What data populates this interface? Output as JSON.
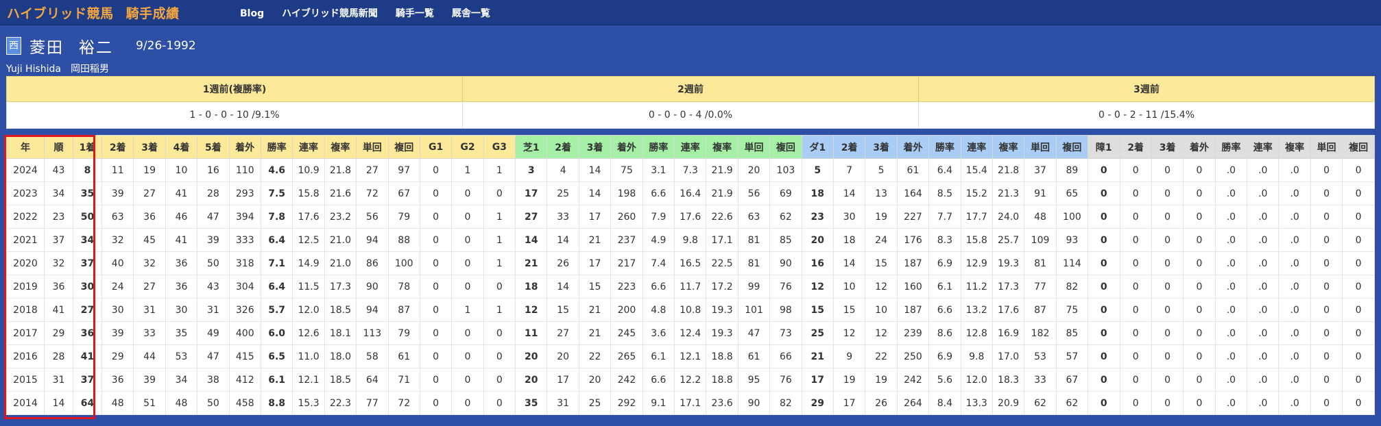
{
  "header": {
    "brand": "ハイブリッド競馬",
    "section": "騎手成績",
    "nav": [
      "Blog",
      "ハイブリッド競馬新聞",
      "騎手一覧",
      "厩舎一覧"
    ]
  },
  "profile": {
    "region": "西",
    "name_family": "菱田",
    "name_given": "裕二",
    "dob": "9/26-1992",
    "name_en": "Yuji Hishida",
    "master": "岡田稲男"
  },
  "weeks": {
    "headers": [
      "1週前(複勝率)",
      "2週前",
      "3週前"
    ],
    "values": [
      "1 - 0 - 0 - 10 /9.1%",
      "0 - 0 - 0 - 4 /0.0%",
      "0 - 0 - 2 - 11 /15.4%"
    ]
  },
  "stats": {
    "headers": [
      "年",
      "順",
      "1着",
      "2着",
      "3着",
      "4着",
      "5着",
      "着外",
      "勝率",
      "連率",
      "複率",
      "単回",
      "複回",
      "G1",
      "G2",
      "G3",
      "芝1",
      "2着",
      "3着",
      "着外",
      "勝率",
      "連率",
      "複率",
      "単回",
      "複回",
      "ダ1",
      "2着",
      "3着",
      "着外",
      "勝率",
      "連率",
      "複率",
      "単回",
      "複回",
      "障1",
      "2着",
      "3着",
      "着外",
      "勝率",
      "連率",
      "複率",
      "単回",
      "複回"
    ],
    "rows": [
      [
        "2024",
        "43",
        "8",
        "11",
        "19",
        "10",
        "16",
        "110",
        "4.6",
        "10.9",
        "21.8",
        "27",
        "97",
        "0",
        "1",
        "1",
        "3",
        "4",
        "14",
        "75",
        "3.1",
        "7.3",
        "21.9",
        "20",
        "103",
        "5",
        "7",
        "5",
        "61",
        "6.4",
        "15.4",
        "21.8",
        "37",
        "89",
        "0",
        "0",
        "0",
        "0",
        ".0",
        ".0",
        ".0",
        "0",
        "0"
      ],
      [
        "2023",
        "34",
        "35",
        "39",
        "27",
        "41",
        "28",
        "293",
        "7.5",
        "15.8",
        "21.6",
        "72",
        "67",
        "0",
        "0",
        "0",
        "17",
        "25",
        "14",
        "198",
        "6.6",
        "16.4",
        "21.9",
        "56",
        "69",
        "18",
        "14",
        "13",
        "164",
        "8.5",
        "15.2",
        "21.3",
        "91",
        "65",
        "0",
        "0",
        "0",
        "0",
        ".0",
        ".0",
        ".0",
        "0",
        "0"
      ],
      [
        "2022",
        "23",
        "50",
        "63",
        "36",
        "46",
        "47",
        "394",
        "7.8",
        "17.6",
        "23.2",
        "56",
        "79",
        "0",
        "0",
        "1",
        "27",
        "33",
        "17",
        "260",
        "7.9",
        "17.6",
        "22.6",
        "63",
        "62",
        "23",
        "30",
        "19",
        "227",
        "7.7",
        "17.7",
        "24.0",
        "48",
        "100",
        "0",
        "0",
        "0",
        "0",
        ".0",
        ".0",
        ".0",
        "0",
        "0"
      ],
      [
        "2021",
        "37",
        "34",
        "32",
        "45",
        "41",
        "39",
        "333",
        "6.4",
        "12.5",
        "21.0",
        "94",
        "88",
        "0",
        "0",
        "1",
        "14",
        "14",
        "21",
        "237",
        "4.9",
        "9.8",
        "17.1",
        "81",
        "85",
        "20",
        "18",
        "24",
        "176",
        "8.3",
        "15.8",
        "25.7",
        "109",
        "93",
        "0",
        "0",
        "0",
        "0",
        ".0",
        ".0",
        ".0",
        "0",
        "0"
      ],
      [
        "2020",
        "32",
        "37",
        "40",
        "32",
        "36",
        "50",
        "318",
        "7.1",
        "14.9",
        "21.0",
        "86",
        "100",
        "0",
        "0",
        "1",
        "21",
        "26",
        "17",
        "217",
        "7.4",
        "16.5",
        "22.5",
        "81",
        "90",
        "16",
        "14",
        "15",
        "187",
        "6.9",
        "12.9",
        "19.3",
        "81",
        "114",
        "0",
        "0",
        "0",
        "0",
        ".0",
        ".0",
        ".0",
        "0",
        "0"
      ],
      [
        "2019",
        "36",
        "30",
        "24",
        "27",
        "36",
        "43",
        "304",
        "6.4",
        "11.5",
        "17.3",
        "90",
        "78",
        "0",
        "0",
        "0",
        "18",
        "14",
        "15",
        "223",
        "6.6",
        "11.7",
        "17.2",
        "99",
        "76",
        "12",
        "10",
        "12",
        "160",
        "6.1",
        "11.2",
        "17.3",
        "77",
        "82",
        "0",
        "0",
        "0",
        "0",
        ".0",
        ".0",
        ".0",
        "0",
        "0"
      ],
      [
        "2018",
        "41",
        "27",
        "30",
        "31",
        "30",
        "31",
        "326",
        "5.7",
        "12.0",
        "18.5",
        "94",
        "87",
        "0",
        "1",
        "1",
        "12",
        "15",
        "21",
        "200",
        "4.8",
        "10.8",
        "19.3",
        "101",
        "98",
        "15",
        "15",
        "10",
        "187",
        "6.6",
        "13.2",
        "17.6",
        "87",
        "75",
        "0",
        "0",
        "0",
        "0",
        ".0",
        ".0",
        ".0",
        "0",
        "0"
      ],
      [
        "2017",
        "29",
        "36",
        "39",
        "33",
        "35",
        "49",
        "400",
        "6.0",
        "12.6",
        "18.1",
        "113",
        "79",
        "0",
        "0",
        "0",
        "11",
        "27",
        "21",
        "245",
        "3.6",
        "12.4",
        "19.3",
        "47",
        "73",
        "25",
        "12",
        "12",
        "239",
        "8.6",
        "12.8",
        "16.9",
        "182",
        "85",
        "0",
        "0",
        "0",
        "0",
        ".0",
        ".0",
        ".0",
        "0",
        "0"
      ],
      [
        "2016",
        "28",
        "41",
        "29",
        "44",
        "53",
        "47",
        "415",
        "6.5",
        "11.0",
        "18.0",
        "58",
        "61",
        "0",
        "0",
        "0",
        "20",
        "20",
        "22",
        "265",
        "6.1",
        "12.1",
        "18.8",
        "61",
        "66",
        "21",
        "9",
        "22",
        "250",
        "6.9",
        "9.8",
        "17.0",
        "53",
        "57",
        "0",
        "0",
        "0",
        "0",
        ".0",
        ".0",
        ".0",
        "0",
        "0"
      ],
      [
        "2015",
        "31",
        "37",
        "36",
        "39",
        "34",
        "38",
        "412",
        "6.1",
        "12.1",
        "18.5",
        "64",
        "71",
        "0",
        "0",
        "0",
        "20",
        "17",
        "20",
        "242",
        "6.6",
        "12.2",
        "18.8",
        "95",
        "76",
        "17",
        "19",
        "19",
        "242",
        "5.6",
        "12.0",
        "18.3",
        "33",
        "67",
        "0",
        "0",
        "0",
        "0",
        ".0",
        ".0",
        ".0",
        "0",
        "0"
      ],
      [
        "2014",
        "14",
        "64",
        "48",
        "51",
        "48",
        "50",
        "458",
        "8.8",
        "15.3",
        "22.3",
        "77",
        "72",
        "0",
        "0",
        "0",
        "35",
        "31",
        "25",
        "292",
        "9.1",
        "17.1",
        "23.6",
        "90",
        "82",
        "29",
        "17",
        "26",
        "264",
        "8.4",
        "13.3",
        "20.9",
        "62",
        "62",
        "0",
        "0",
        "0",
        "0",
        ".0",
        ".0",
        ".0",
        "0",
        "0"
      ]
    ]
  }
}
